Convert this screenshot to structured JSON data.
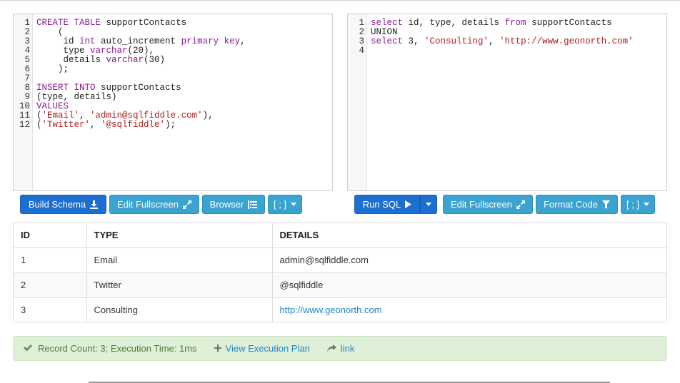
{
  "schema_editor": {
    "lines": [
      {
        "n": "1",
        "tokens": [
          {
            "t": "CREATE",
            "c": "kw"
          },
          {
            "t": " "
          },
          {
            "t": "TABLE",
            "c": "kw"
          },
          {
            "t": " supportContacts"
          }
        ]
      },
      {
        "n": "2",
        "tokens": [
          {
            "t": "    ("
          }
        ]
      },
      {
        "n": "3",
        "tokens": [
          {
            "t": "     id "
          },
          {
            "t": "int",
            "c": "kw"
          },
          {
            "t": " auto_increment "
          },
          {
            "t": "primary",
            "c": "kw"
          },
          {
            "t": " "
          },
          {
            "t": "key",
            "c": "kw"
          },
          {
            "t": ","
          }
        ]
      },
      {
        "n": "4",
        "tokens": [
          {
            "t": "     type "
          },
          {
            "t": "varchar",
            "c": "kw"
          },
          {
            "t": "(20),"
          }
        ]
      },
      {
        "n": "5",
        "tokens": [
          {
            "t": "     details "
          },
          {
            "t": "varchar",
            "c": "kw"
          },
          {
            "t": "(30)"
          }
        ]
      },
      {
        "n": "6",
        "tokens": [
          {
            "t": "    );"
          }
        ]
      },
      {
        "n": "7",
        "tokens": []
      },
      {
        "n": "8",
        "tokens": [
          {
            "t": "INSERT",
            "c": "kw"
          },
          {
            "t": " "
          },
          {
            "t": "INTO",
            "c": "kw"
          },
          {
            "t": " supportContacts"
          }
        ]
      },
      {
        "n": "9",
        "tokens": [
          {
            "t": "(type, details)"
          }
        ]
      },
      {
        "n": "10",
        "tokens": [
          {
            "t": "VALUES",
            "c": "kw"
          }
        ]
      },
      {
        "n": "11",
        "tokens": [
          {
            "t": "("
          },
          {
            "t": "'Email'",
            "c": "str"
          },
          {
            "t": ", "
          },
          {
            "t": "'admin@sqlfiddle.com'",
            "c": "str"
          },
          {
            "t": "),"
          }
        ]
      },
      {
        "n": "12",
        "tokens": [
          {
            "t": "("
          },
          {
            "t": "'Twitter'",
            "c": "str"
          },
          {
            "t": ", "
          },
          {
            "t": "'@sqlfiddle'",
            "c": "str"
          },
          {
            "t": ");"
          }
        ]
      }
    ]
  },
  "query_editor": {
    "lines": [
      {
        "n": "1",
        "tokens": [
          {
            "t": "select",
            "c": "kw"
          },
          {
            "t": " id, type, details "
          },
          {
            "t": "from",
            "c": "kw"
          },
          {
            "t": " supportContacts"
          }
        ]
      },
      {
        "n": "2",
        "tokens": [
          {
            "t": "UNION"
          }
        ]
      },
      {
        "n": "3",
        "tokens": [
          {
            "t": "select",
            "c": "kw"
          },
          {
            "t": " 3, "
          },
          {
            "t": "'Consulting'",
            "c": "str"
          },
          {
            "t": ", "
          },
          {
            "t": "'http://www.geonorth.com'",
            "c": "str"
          }
        ]
      },
      {
        "n": "4",
        "tokens": []
      }
    ]
  },
  "toolbar_left": {
    "build_schema": "Build Schema",
    "edit_fullscreen": "Edit Fullscreen",
    "browser": "Browser",
    "terminator": "[ ; ]"
  },
  "toolbar_right": {
    "run_sql": "Run SQL",
    "edit_fullscreen": "Edit Fullscreen",
    "format_code": "Format Code",
    "terminator": "[ ; ]"
  },
  "results": {
    "columns": [
      "ID",
      "TYPE",
      "DETAILS"
    ],
    "rows": [
      [
        "1",
        "Email",
        "admin@sqlfiddle.com"
      ],
      [
        "2",
        "Twitter",
        "@sqlfiddle"
      ],
      [
        "3",
        "Consulting",
        "http://www.geonorth.com"
      ]
    ]
  },
  "status": {
    "summary": "Record Count: 3; Execution Time: 1ms",
    "view_plan": "View Execution Plan",
    "link": "link"
  },
  "colors": {
    "primary": "#1d6ed1",
    "info": "#3aa3d0",
    "keyword": "#8b1a94",
    "string": "#b11e1e",
    "success_bg": "#dff0d8",
    "link": "#1f86c7"
  },
  "icons": {
    "build": "download-icon",
    "fullscreen": "expand-icon",
    "browser": "tree-list-icon",
    "caret": "caret-down-icon",
    "run": "play-icon",
    "format": "filter-icon",
    "ok": "check-icon",
    "plan": "plus-icon",
    "link": "share-arrow-icon"
  }
}
